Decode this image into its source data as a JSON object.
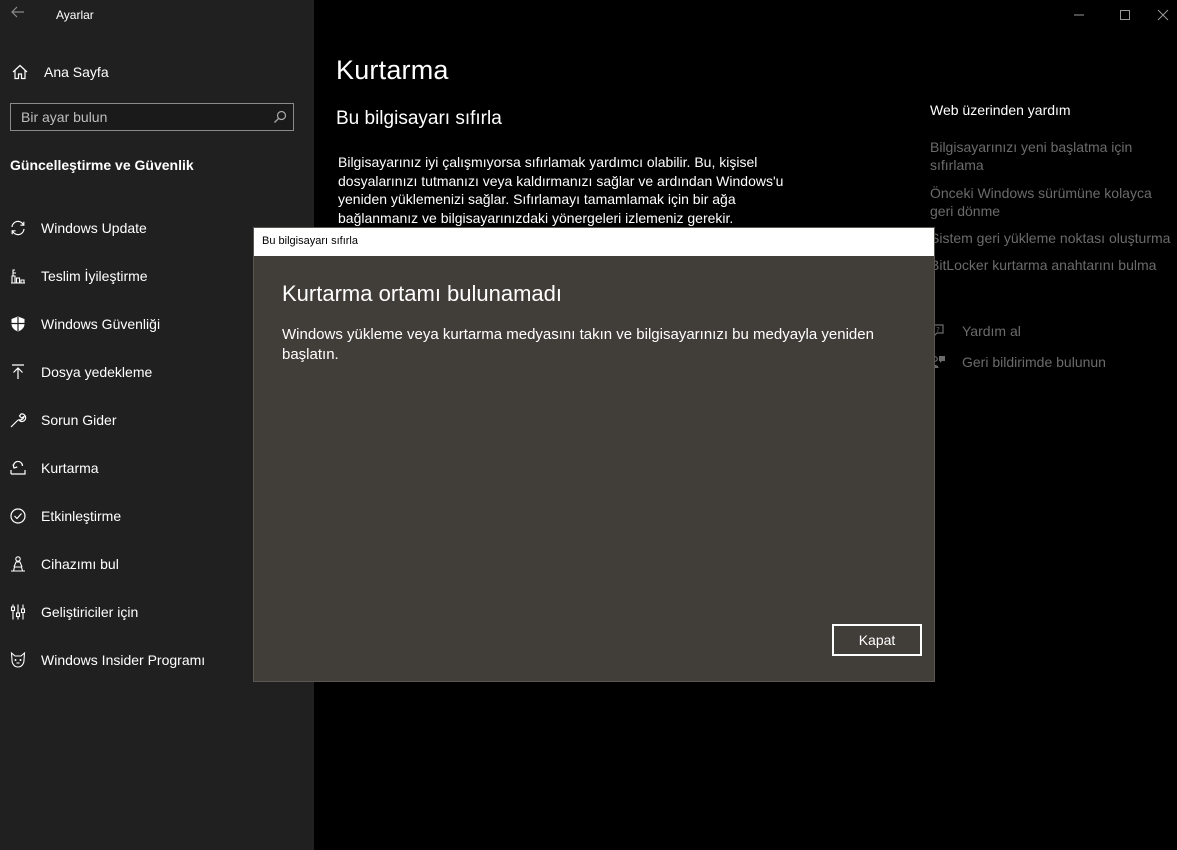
{
  "window": {
    "title": "Ayarlar"
  },
  "sidebar": {
    "home_label": "Ana Sayfa",
    "search_placeholder": "Bir ayar bulun",
    "section_title": "Güncelleştirme ve Güvenlik",
    "items": [
      {
        "label": "Windows Update",
        "icon": "sync-icon"
      },
      {
        "label": "Teslim İyileştirme",
        "icon": "delivery-icon"
      },
      {
        "label": "Windows Güvenliği",
        "icon": "shield-icon"
      },
      {
        "label": "Dosya yedekleme",
        "icon": "upload-arrow-icon"
      },
      {
        "label": "Sorun Gider",
        "icon": "wrench-icon"
      },
      {
        "label": "Kurtarma",
        "icon": "recovery-icon"
      },
      {
        "label": "Etkinleştirme",
        "icon": "check-circle-icon"
      },
      {
        "label": "Cihazımı bul",
        "icon": "person-location-icon"
      },
      {
        "label": "Geliştiriciler için",
        "icon": "developer-sliders-icon"
      },
      {
        "label": "Windows Insider Programı",
        "icon": "insider-cat-icon"
      }
    ]
  },
  "main": {
    "title": "Kurtarma",
    "section": "Bu bilgisayarı sıfırla",
    "description": "Bilgisayarınız iyi çalışmıyorsa sıfırlamak yardımcı olabilir. Bu, kişisel dosyalarınızı tutmanızı veya kaldırmanızı sağlar ve ardından Windows'u yeniden yüklemenizi sağlar. Sıfırlamayı tamamlamak için bir ağa bağlanmanız ve bilgisayarınızdaki yönergeleri izlemeniz gerekir."
  },
  "help": {
    "title": "Web üzerinden yardım",
    "links": [
      "Bilgisayarınızı yeni başlatma için sıfırlama",
      "Önceki Windows sürümüne kolayca geri dönme",
      "Sistem geri yükleme noktası oluşturma",
      "BitLocker kurtarma anahtarını bulma"
    ],
    "get_help": "Yardım al",
    "feedback": "Geri bildirimde bulunun"
  },
  "dialog": {
    "title": "Bu bilgisayarı sıfırla",
    "heading": "Kurtarma ortamı bulunamadı",
    "message": "Windows yükleme veya kurtarma medyasını takın ve bilgisayarınızı bu medyayla yeniden başlatın.",
    "button": "Kapat"
  }
}
